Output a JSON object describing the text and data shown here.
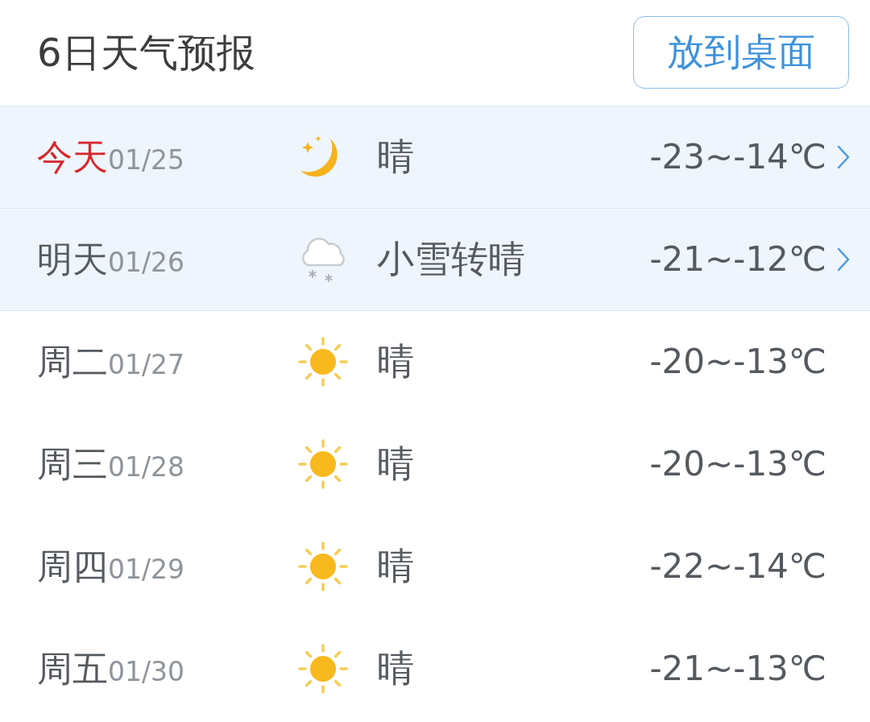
{
  "header": {
    "title": "6日天气预报",
    "button": "放到桌面"
  },
  "days": [
    {
      "day": "今天",
      "date": "01/25",
      "is_today": true,
      "kind": "moon",
      "condition": "晴",
      "temperature": "-23~-14℃",
      "highlighted": true
    },
    {
      "day": "明天",
      "date": "01/26",
      "is_today": false,
      "kind": "snow_cloud",
      "condition": "小雪转晴",
      "temperature": "-21~-12℃",
      "highlighted": true
    },
    {
      "day": "周二",
      "date": "01/27",
      "is_today": false,
      "kind": "sun",
      "condition": "晴",
      "temperature": "-20~-13℃",
      "highlighted": false
    },
    {
      "day": "周三",
      "date": "01/28",
      "is_today": false,
      "kind": "sun",
      "condition": "晴",
      "temperature": "-20~-13℃",
      "highlighted": false
    },
    {
      "day": "周四",
      "date": "01/29",
      "is_today": false,
      "kind": "sun",
      "condition": "晴",
      "temperature": "-22~-14℃",
      "highlighted": false
    },
    {
      "day": "周五",
      "date": "01/30",
      "is_today": false,
      "kind": "sun",
      "condition": "晴",
      "temperature": "-21~-13℃",
      "highlighted": false
    }
  ]
}
